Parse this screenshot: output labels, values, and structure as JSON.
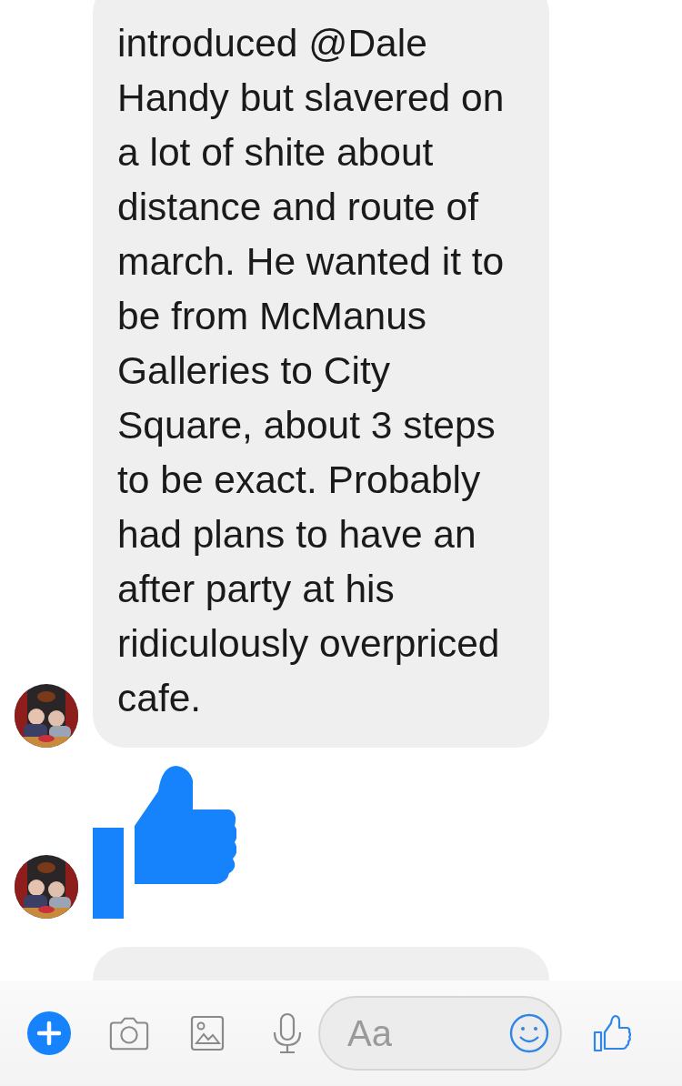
{
  "messages": [
    {
      "kind": "text",
      "lines": [
        "introduced @Dale",
        "Handy but slavered on",
        "a lot of shite about",
        "distance and route of",
        "march. He wanted it to",
        "be from McManus",
        "Galleries to City",
        "Square, about 3 steps",
        "to be exact. Probably",
        "had plans to have an",
        "after party at his",
        "ridiculously overpriced",
        "cafe."
      ],
      "avatar": true
    },
    {
      "kind": "like",
      "avatar": true
    },
    {
      "kind": "text",
      "avatar": false
    }
  ],
  "composer": {
    "placeholder": "Aa"
  }
}
